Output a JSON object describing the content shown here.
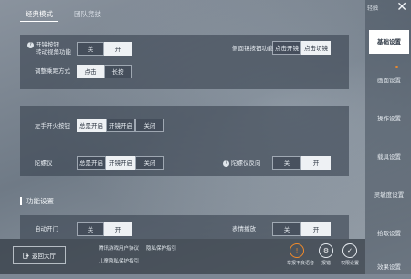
{
  "tabs": [
    {
      "label": "经典模式",
      "active": true
    },
    {
      "label": "团队竞技",
      "active": false
    }
  ],
  "panel1": {
    "scope_turn": {
      "label_line1": "开镜按钮",
      "label_line2": "转动视角功能",
      "options": [
        "关",
        "开"
      ],
      "selected": "开"
    },
    "side_scope": {
      "label": "侧面镜按钮功能",
      "options": [
        "点击开镜",
        "点击切镜"
      ],
      "selected": "点击切镜"
    },
    "range_adjust": {
      "label": "调整乘距方式",
      "options": [
        "点击",
        "长按"
      ],
      "selected": "点击"
    }
  },
  "panel2": {
    "left_fire": {
      "label": "左手开火按钮",
      "options": [
        "总是开启",
        "开镜开启",
        "关闭"
      ],
      "selected": "总是开启"
    },
    "gyroscope": {
      "label": "陀螺仪",
      "options": [
        "总是开启",
        "开镜开启",
        "关闭"
      ],
      "selected": "开镜开启"
    },
    "gyro_reverse": {
      "label": "陀螺仪反向",
      "options": [
        "关",
        "开"
      ],
      "selected": "开"
    }
  },
  "section": {
    "title": "功能设置"
  },
  "panel3": {
    "auto_door": {
      "label": "自动开门",
      "options": [
        "关",
        "开"
      ],
      "selected": "开"
    },
    "emote": {
      "label": "表情播放",
      "options": [
        "关",
        "开"
      ],
      "selected": "开"
    }
  },
  "bottom": {
    "back_label": "返回大厅",
    "links": [
      "腾讯游戏用户协议",
      "隐私保护指引",
      "儿童隐私保护指引"
    ],
    "icons": [
      {
        "name": "report-icon",
        "caption": "举报不良语音",
        "glyph": "!"
      },
      {
        "name": "feedback-icon",
        "caption": "报错",
        "glyph": "⚙"
      },
      {
        "name": "permission-icon",
        "caption": "权限设置",
        "glyph": "✓"
      }
    ]
  },
  "sidebar": {
    "hint": "轻触",
    "items": [
      "基础设置",
      "画面设置",
      "操作设置",
      "载具设置",
      "灵敏度设置",
      "拾取设置",
      "效果设置"
    ],
    "active_index": 0
  },
  "colors": {
    "accent_dot": "#f08a2a",
    "selected_bg": "#eef1f4"
  }
}
